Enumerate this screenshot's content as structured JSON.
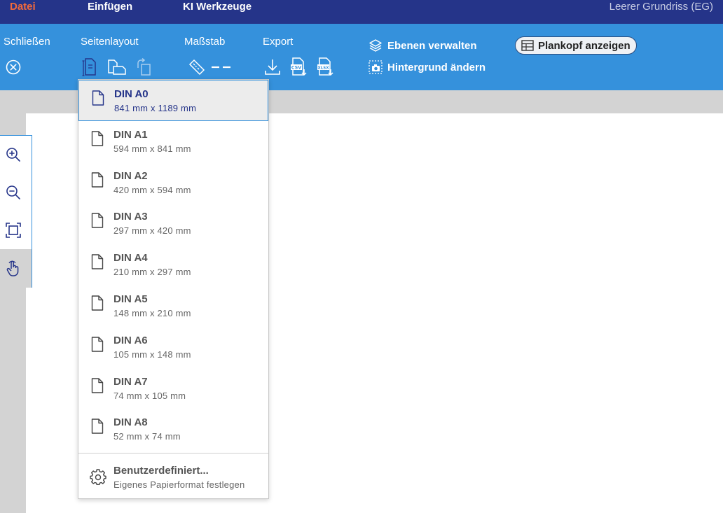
{
  "menubar": {
    "tabs": [
      {
        "label": "Datei",
        "active": true
      },
      {
        "label": "Einfügen",
        "active": false
      },
      {
        "label": "KI Werkzeuge",
        "active": false
      }
    ],
    "document_title": "Leerer Grundriss (EG)"
  },
  "ribbon": {
    "close_label": "Schließen",
    "page_layout_label": "Seitenlayout",
    "scale_label": "Maßstab",
    "export_label": "Export",
    "layers_label": "Ebenen verwalten",
    "background_label": "Hintergrund ändern",
    "plankopf_label": "Plankopf anzeigen",
    "export_icons": [
      "download-icon",
      "csv-export-icon",
      "xlsx-export-icon"
    ],
    "csv_tag": "CSV",
    "xlsx_tag": "XLSX"
  },
  "left_toolbar": {
    "tools": [
      {
        "name": "zoom-in-icon",
        "active": false
      },
      {
        "name": "zoom-out-icon",
        "active": false
      },
      {
        "name": "fit-view-icon",
        "active": false
      },
      {
        "name": "pan-hand-icon",
        "active": true
      }
    ]
  },
  "dropdown": {
    "formats": [
      {
        "title": "DIN A0",
        "size": "841 mm x 1189 mm",
        "selected": true
      },
      {
        "title": "DIN A1",
        "size": "594 mm x 841 mm",
        "selected": false
      },
      {
        "title": "DIN A2",
        "size": "420 mm x 594 mm",
        "selected": false
      },
      {
        "title": "DIN A3",
        "size": "297 mm x 420 mm",
        "selected": false
      },
      {
        "title": "DIN A4",
        "size": "210 mm x 297 mm",
        "selected": false
      },
      {
        "title": "DIN A5",
        "size": "148 mm x 210 mm",
        "selected": false
      },
      {
        "title": "DIN A6",
        "size": "105 mm x 148 mm",
        "selected": false
      },
      {
        "title": "DIN A7",
        "size": "74 mm x 105 mm",
        "selected": false
      },
      {
        "title": "DIN A8",
        "size": "52 mm x 74 mm",
        "selected": false
      }
    ],
    "custom": {
      "title": "Benutzerdefiniert...",
      "subtitle": "Eigenes Papierformat festlegen"
    }
  },
  "colors": {
    "menubar_bg": "#253489",
    "ribbon_bg": "#3591dc",
    "active_tab": "#f26a3b",
    "selected_text": "#253489",
    "canvas_bg": "#d3d3d3"
  }
}
